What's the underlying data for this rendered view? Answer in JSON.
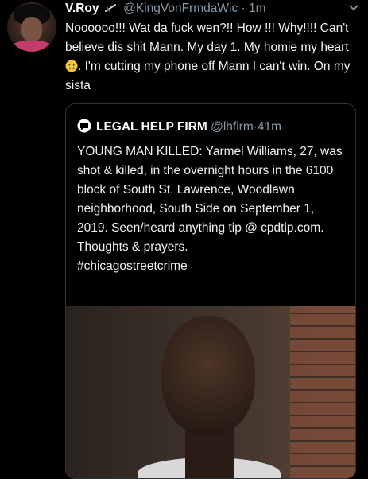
{
  "tweet": {
    "display_name": "V.Roy",
    "handle": "@KingVonFrmdaWic",
    "separator": "·",
    "time": "1m",
    "text_part1": "Noooooo!!! Wat da fuck wen?!! How !!! Why!!!! Can't believe dis shit Mann. My day 1. My homie my heart ",
    "emoji_name": "crying-face",
    "text_part2": ". I'm cutting my phone off Mann I can't win. On my sista"
  },
  "quoted_tweet": {
    "display_name": "LEGAL HELP FIRM",
    "handle": "@lhfirm",
    "separator": "·",
    "time": "41m",
    "text": "YOUNG MAN KILLED: Yarmel Williams, 27, was shot & killed, in the overnight hours in the 6100 block of South St. Lawrence, Woodlawn neighborhood, South Side on September 1, 2019. Seen/heard anything tip @ cpdtip.com. Thoughts & prayers.",
    "hashtag": "#chicagostreetcrime"
  },
  "colors": {
    "background": "#000000",
    "text": "#f2f2f2",
    "secondary": "#8899a6",
    "border": "#2f3336"
  },
  "icons": {
    "verified": "sword-emoji-icon",
    "menu": "chevron-down-icon",
    "quote_logo": "chat-bubble-logo-icon"
  }
}
